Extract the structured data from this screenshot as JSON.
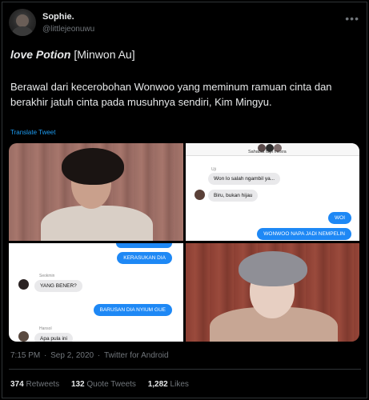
{
  "author": {
    "display_name": "Sophie.",
    "handle": "@littlejeonuwu"
  },
  "more_icon": "more-options-icon",
  "tweet": {
    "title_bold": "love Potion",
    "title_rest": " [Minwon Au]",
    "body": "Berawal dari kecerobohan Wonwoo yang meminum ramuan cinta dan berakhir jatuh cinta pada musuhnya sendiri, Kim Mingyu.",
    "translate_label": "Translate Tweet"
  },
  "chat_top": {
    "header": "Sahabat tapi mesra",
    "sender1": "Uji",
    "msg1": "Won lo salah ngambil ya...",
    "msg2": "Biru, bukan hijau",
    "msg3": "WOI",
    "msg4": "WONWOO NAPA JADI NEMPELIN"
  },
  "chat_bottom": {
    "msg1": "KERASUKAN DIA",
    "sender1": "Seokmin",
    "msg2": "YANG BENER?",
    "msg3": "BARUSAN DIA NYIUM GUE",
    "sender2": "Hansol",
    "msg4": "Apa pula ini"
  },
  "meta": {
    "time": "7:15 PM",
    "date": "Sep 2, 2020",
    "source": "Twitter for Android"
  },
  "stats": {
    "retweets": "374",
    "retweets_label": "Retweets",
    "quotes": "132",
    "quotes_label": "Quote Tweets",
    "likes": "1,282",
    "likes_label": "Likes"
  }
}
